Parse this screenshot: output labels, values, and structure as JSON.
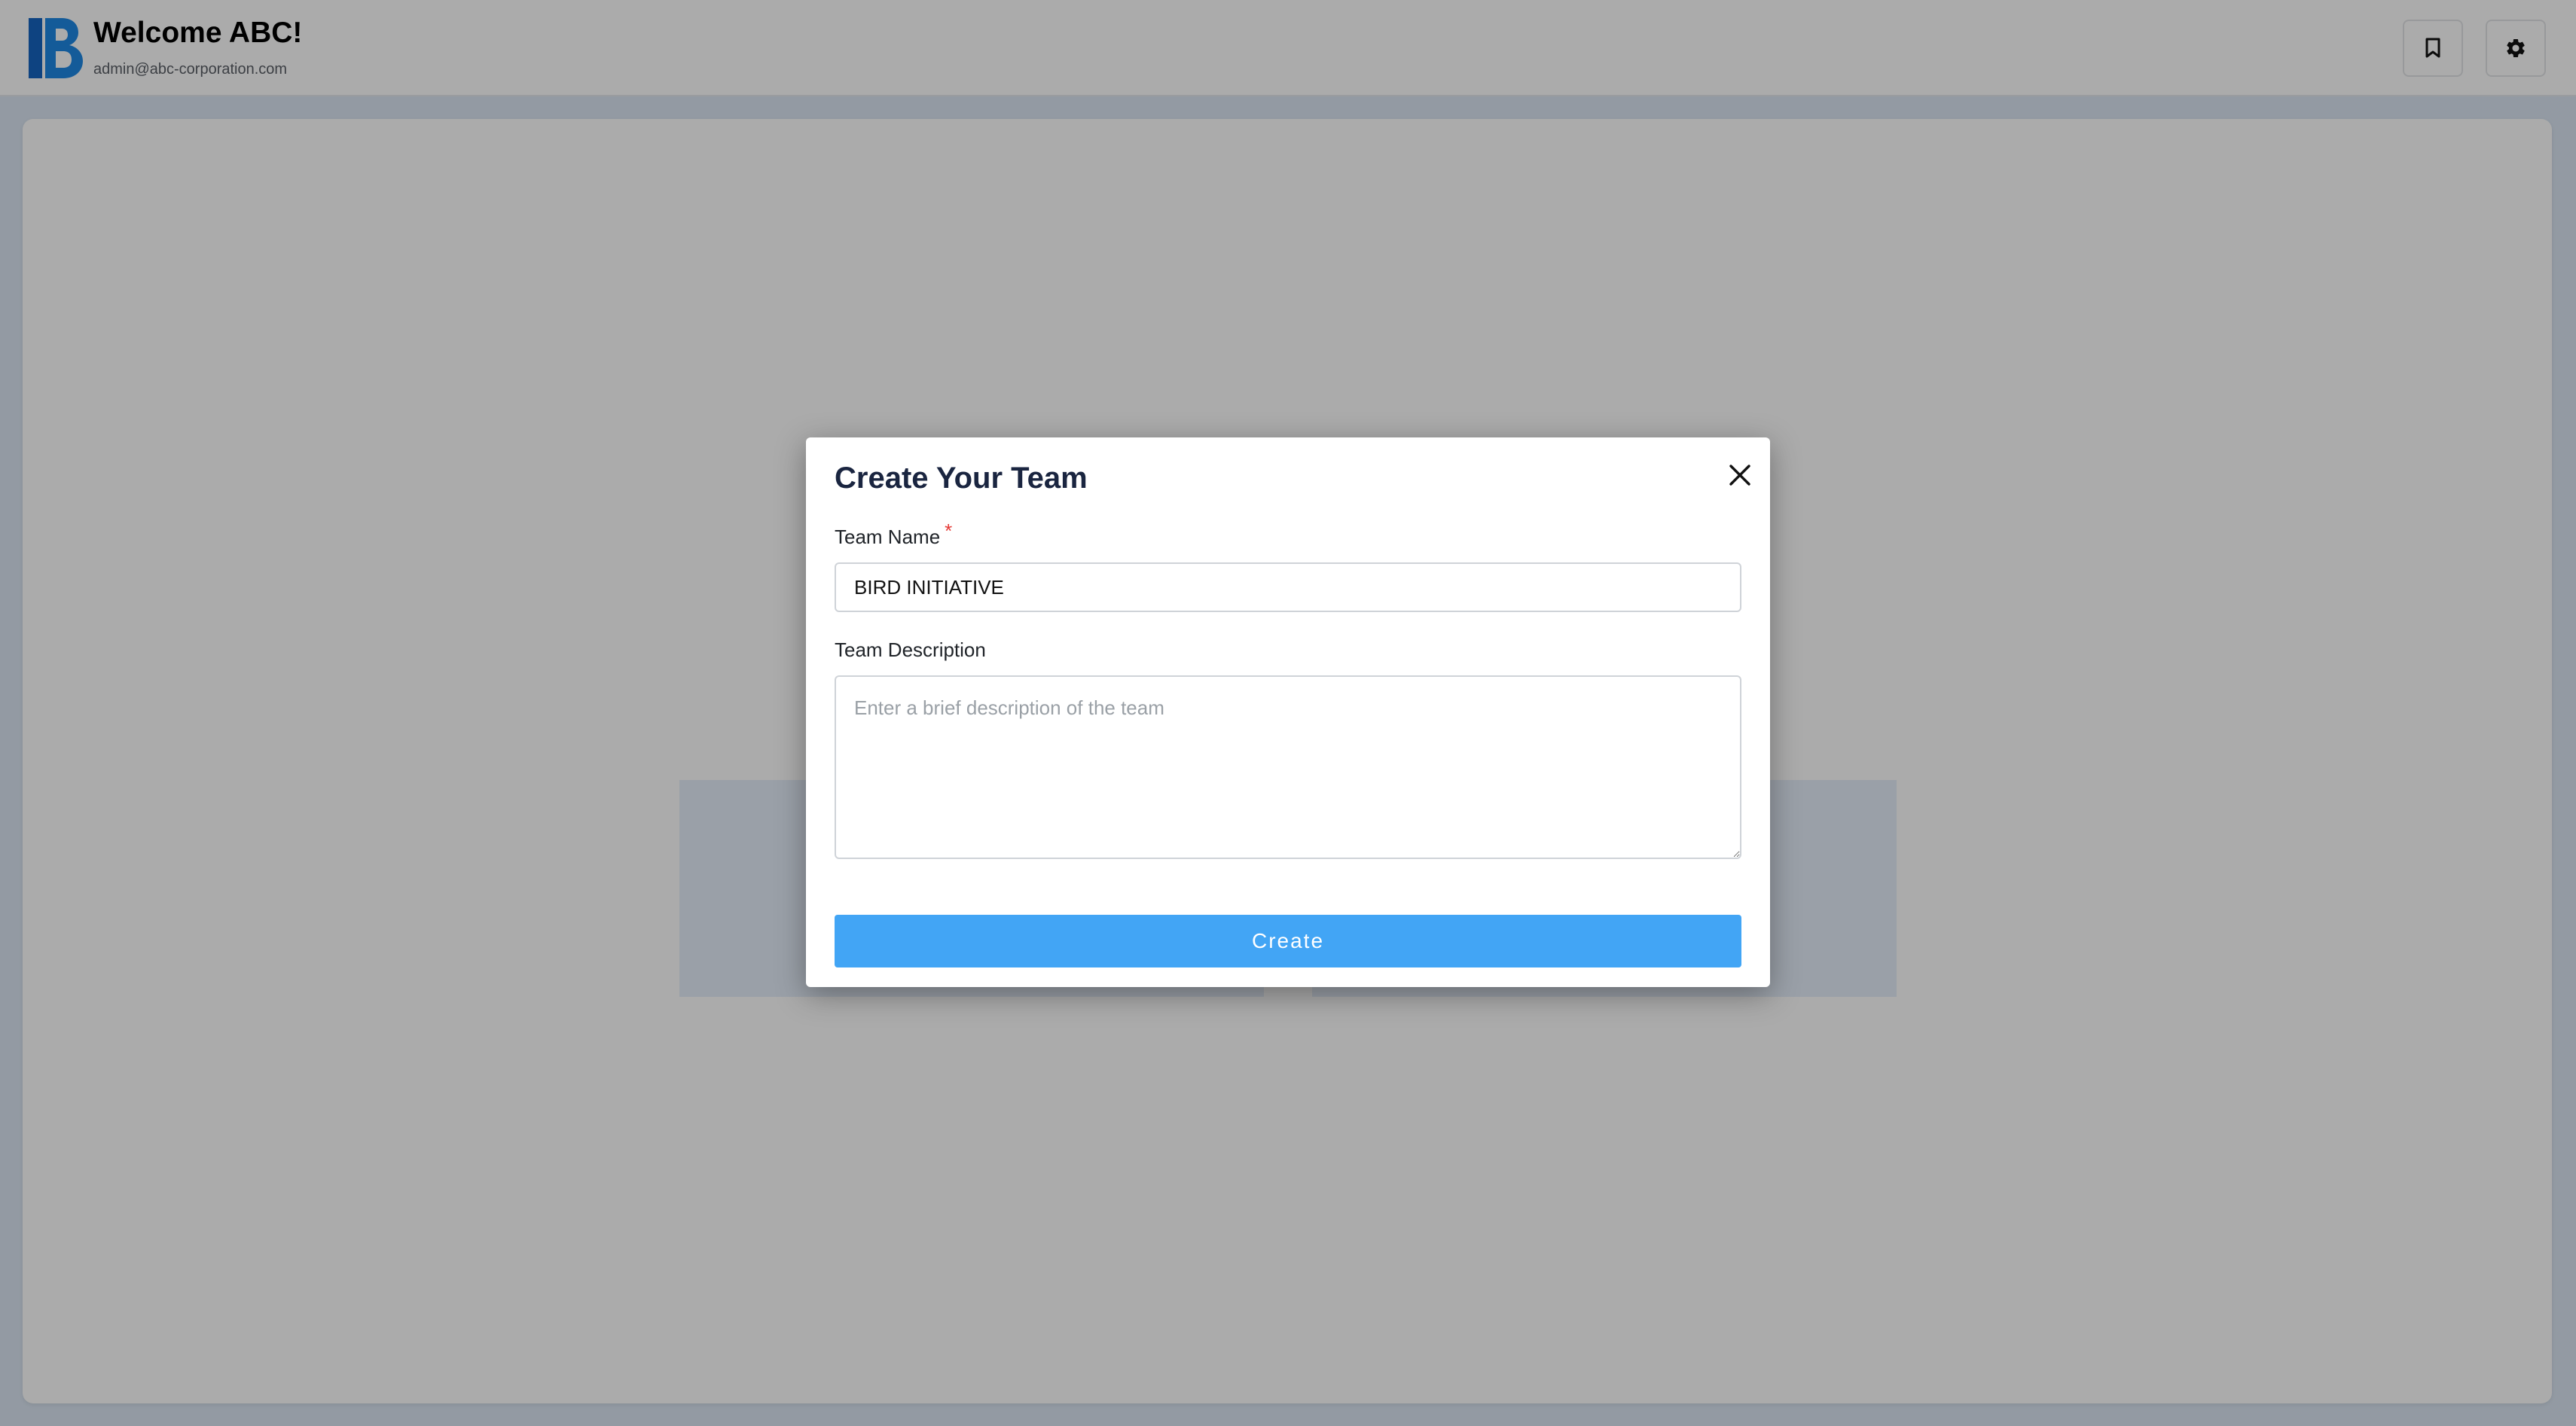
{
  "header": {
    "welcome": "Welcome ABC!",
    "email": "admin@abc-corporation.com",
    "bookmark_icon": "bookmark-icon",
    "settings_icon": "gear-icon"
  },
  "modal": {
    "title": "Create Your Team",
    "close_icon": "close-icon",
    "team_name_label": "Team Name",
    "required_marker": "*",
    "team_name_value": "BIRD INITIATIVE",
    "team_description_label": "Team Description",
    "team_description_placeholder": "Enter a brief description of the team",
    "create_label": "Create"
  },
  "colors": {
    "brand_blue": "#1e7fd1",
    "primary_button": "#42a5f5",
    "required": "#e53935",
    "title": "#1a2540"
  }
}
